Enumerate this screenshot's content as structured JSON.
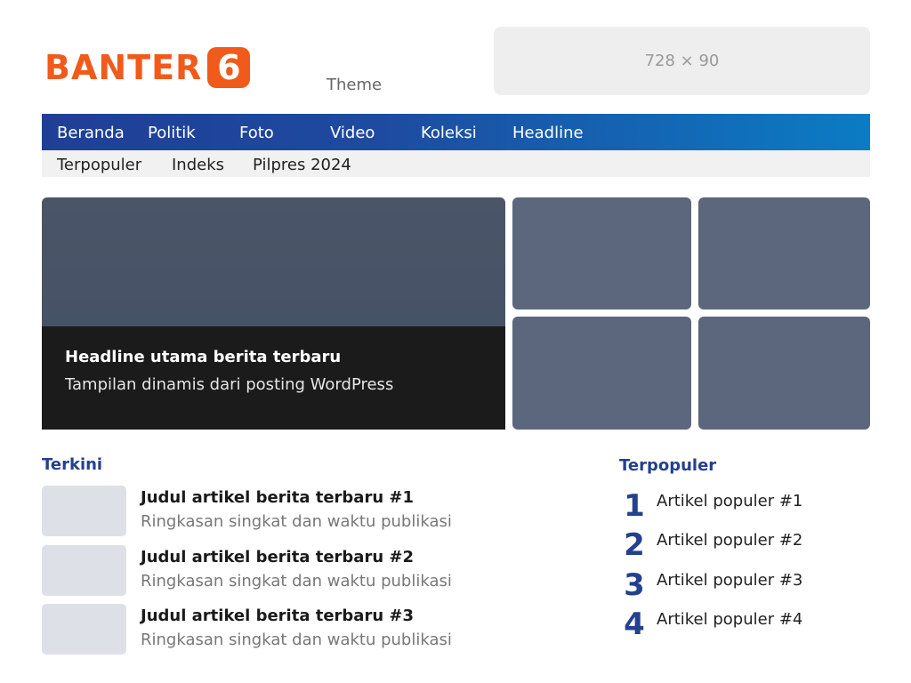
{
  "header": {
    "logo_text": "BANTER",
    "logo_badge": "6",
    "theme_label": "Theme",
    "ad_label": "728 × 90"
  },
  "main_nav": [
    "Beranda",
    "Politik",
    "Foto",
    "Video",
    "Koleksi",
    "Headline"
  ],
  "sub_nav": [
    "Terpopuler",
    "Indeks",
    "Pilpres 2024"
  ],
  "hero": {
    "title": "Headline utama berita terbaru",
    "subtitle": "Tampilan dinamis dari posting WordPress"
  },
  "latest": {
    "heading": "Terkini",
    "articles": [
      {
        "title": "Judul artikel berita terbaru #1",
        "summary": "Ringkasan singkat dan waktu publikasi"
      },
      {
        "title": "Judul artikel berita terbaru #2",
        "summary": "Ringkasan singkat dan waktu publikasi"
      },
      {
        "title": "Judul artikel berita terbaru #3",
        "summary": "Ringkasan singkat dan waktu publikasi"
      }
    ]
  },
  "popular": {
    "heading": "Terpopuler",
    "items": [
      {
        "rank": "1",
        "label": "Artikel populer #1"
      },
      {
        "rank": "2",
        "label": "Artikel populer #2"
      },
      {
        "rank": "3",
        "label": "Artikel populer #3"
      },
      {
        "rank": "4",
        "label": "Artikel populer #4"
      }
    ]
  },
  "colors": {
    "brand_orange": "#f05a1a",
    "nav_blue_start": "#1f3f95",
    "nav_blue_end": "#0b7cc4",
    "heading_blue": "#24418f"
  }
}
